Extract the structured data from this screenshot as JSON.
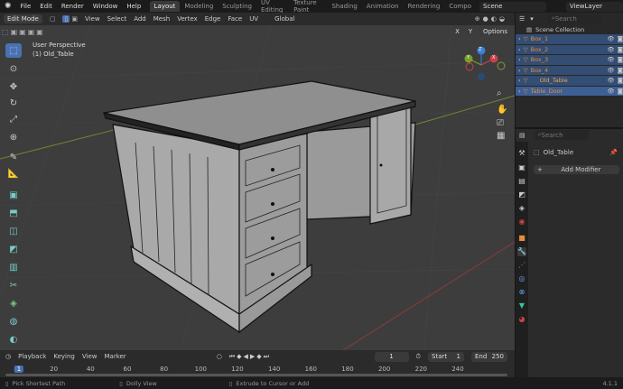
{
  "menu": [
    "File",
    "Edit",
    "Render",
    "Window",
    "Help"
  ],
  "workspaces": [
    "Layout",
    "Modeling",
    "Sculpting",
    "UV Editing",
    "Texture Paint",
    "Shading",
    "Animation",
    "Rendering",
    "Compo"
  ],
  "scene": "Scene",
  "view_layer": "ViewLayer",
  "viewport_header": {
    "mode": "Edit Mode",
    "menus": [
      "View",
      "Select",
      "Add",
      "Mesh",
      "Vertex",
      "Edge",
      "Face",
      "UV"
    ],
    "orientation": "Global",
    "options": "Options",
    "axes": [
      "X",
      "Y",
      "Z"
    ]
  },
  "overlay": {
    "perspective": "User Perspective",
    "object": "(1) Old_Table"
  },
  "gizmo": {
    "z": "Z",
    "y": "Y",
    "x": "X"
  },
  "outliner": {
    "search_placeholder": "Search",
    "collection": "Scene Collection",
    "items": [
      "Box_1",
      "Box_2",
      "Box_3",
      "Box_4",
      "Old_Table",
      "Table_Door"
    ]
  },
  "properties": {
    "search_placeholder": "Search",
    "object": "Old_Table",
    "add_modifier": "Add Modifier"
  },
  "timeline": {
    "menus": [
      "Playback",
      "Keying",
      "View",
      "Marker"
    ],
    "current_frame": "1",
    "start_label": "Start",
    "start": "1",
    "end_label": "End",
    "end": "250",
    "ticks": [
      "1",
      "20",
      "40",
      "60",
      "80",
      "100",
      "120",
      "140",
      "160",
      "180",
      "200",
      "220",
      "240"
    ]
  },
  "status": {
    "hints": [
      "Pick Shortest Path",
      "Dolly View",
      "Extrude to Cursor or Add"
    ],
    "version": "4.1.1"
  }
}
